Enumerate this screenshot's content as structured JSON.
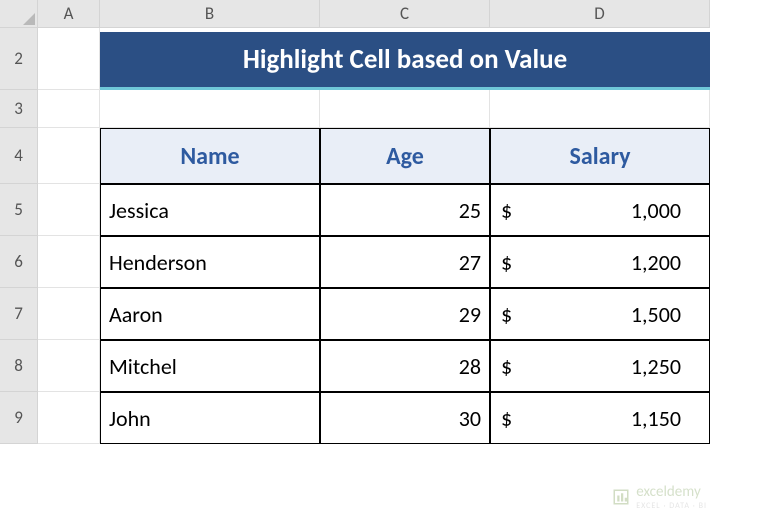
{
  "columns": [
    "A",
    "B",
    "C",
    "D"
  ],
  "rows": [
    "2",
    "3",
    "4",
    "5",
    "6",
    "7",
    "8",
    "9"
  ],
  "title": "Highlight Cell based on Value",
  "headers": {
    "name": "Name",
    "age": "Age",
    "salary": "Salary"
  },
  "currency": "$",
  "data": [
    {
      "name": "Jessica",
      "age": "25",
      "salary": "1,000"
    },
    {
      "name": "Henderson",
      "age": "27",
      "salary": "1,200"
    },
    {
      "name": "Aaron",
      "age": "29",
      "salary": "1,500"
    },
    {
      "name": "Mitchel",
      "age": "28",
      "salary": "1,250"
    },
    {
      "name": "John",
      "age": "30",
      "salary": "1,150"
    }
  ],
  "watermark": {
    "text": "exceldemy",
    "sub": "EXCEL · DATA · BI"
  },
  "chart_data": {
    "type": "table",
    "title": "Highlight Cell based on Value",
    "columns": [
      "Name",
      "Age",
      "Salary"
    ],
    "rows": [
      [
        "Jessica",
        25,
        1000
      ],
      [
        "Henderson",
        27,
        1200
      ],
      [
        "Aaron",
        29,
        1500
      ],
      [
        "Mitchel",
        28,
        1250
      ],
      [
        "John",
        30,
        1150
      ]
    ]
  }
}
